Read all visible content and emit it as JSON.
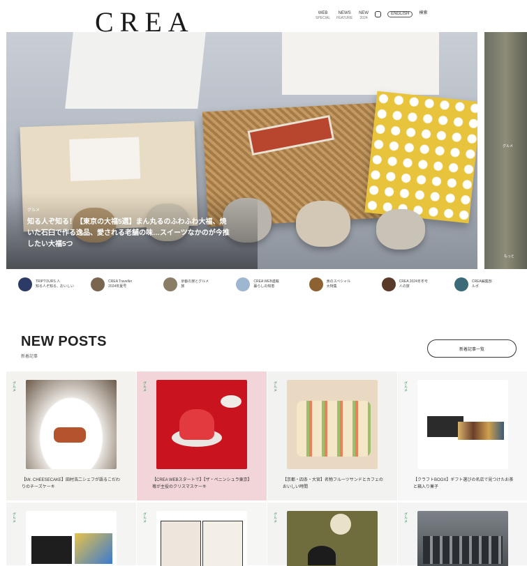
{
  "header": {
    "logo": "CREA",
    "nav": [
      {
        "label": "WEB",
        "sub": "SPECIAL"
      },
      {
        "label": "NEWS",
        "sub": "FEATURE"
      },
      {
        "label": "NEW",
        "sub": "2024"
      },
      {
        "label": "◆",
        "sub": ""
      }
    ],
    "lang": "ENGLISH",
    "search_label": "検索"
  },
  "hero": {
    "category": "グルメ",
    "title": "知る人ぞ知る！【東京の大福5選】まん丸るのふわふわ大福、焼いた石臼で作る逸品、愛される老舗の味…スイーツなかのが今推したい大福5つ",
    "side_text_top": "グルメ",
    "side_text_bottom": "もっと"
  },
  "authors": [
    {
      "line1": "TRIPTOURS 人",
      "line2": "知る人ぞ知る、おいしい"
    },
    {
      "line1": "CREA Traveller",
      "line2": "2024年夏号"
    },
    {
      "line1": "京都の旅とグルメ",
      "line2": "旅"
    },
    {
      "line1": "CREA WEB連載",
      "line2": "暮らしの知恵"
    },
    {
      "line1": "食のスペシャル",
      "line2": "大特集"
    },
    {
      "line1": "CREA 2024年冬号",
      "line2": "人の旅"
    },
    {
      "line1": "CREA編集部",
      "line2": "ルポ"
    }
  ],
  "new_posts": {
    "title": "NEW POSTS",
    "subtitle": "新着記事",
    "more_button": "新着記事一覧"
  },
  "cards": [
    {
      "tag": "グルメ",
      "caption": "【Mr. CHEESECAKE】田村浩二シェフが語るこだわりのチーズケーキ"
    },
    {
      "tag": "グルメ",
      "caption": "【CREA WEBスタートで】【ザ・ペニンシュラ東京】苺が主役のクリスマスケーキ"
    },
    {
      "tag": "グルメ",
      "caption": "【京都・四条・大宮】名物フルーツサンドとカフェのおいしい時間"
    },
    {
      "tag": "グルメ",
      "caption": "【クラフトBOOX】ギフト選びの名店で見つけたお茶と箱入り菓子"
    },
    {
      "tag": "グルメ",
      "caption": ""
    },
    {
      "tag": "グルメ",
      "caption": ""
    },
    {
      "tag": "グルメ",
      "caption": ""
    },
    {
      "tag": "グルメ",
      "caption": ""
    }
  ]
}
